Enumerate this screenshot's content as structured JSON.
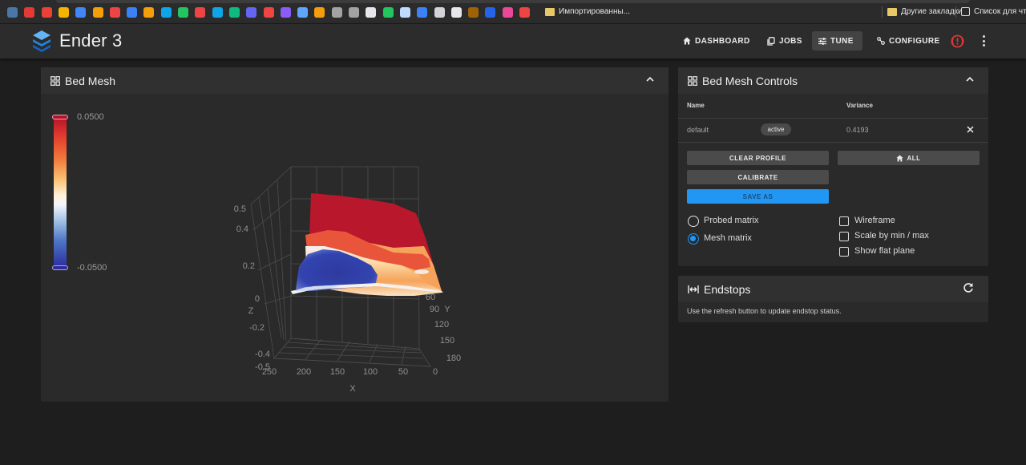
{
  "browser": {
    "bookmark_folder_1": "Импортированны...",
    "bookmark_folder_2": "Другие закладки",
    "reading_list": "Список для чтени",
    "bookmark_icon_colors": [
      "#4a76a8",
      "#e53935",
      "#ea4335",
      "#f4b400",
      "#4285f4",
      "#f59e0b",
      "#ef4444",
      "#3b82f6",
      "#f59e0b",
      "#0ea5e9",
      "#22c55e",
      "#ef4444",
      "#0ea5e9",
      "#10b981",
      "#6366f1",
      "#ef4444",
      "#8b5cf6",
      "#60a5fa",
      "#f59e0b",
      "#a3a3a3",
      "#a3a3a3",
      "#e5e7eb",
      "#22c55e",
      "#bfdbfe",
      "#3b82f6",
      "#d4d4d8",
      "#e5e7eb",
      "#a16207",
      "#2563eb",
      "#ec4899",
      "#ef4444"
    ]
  },
  "app": {
    "title": "Ender 3",
    "nav": {
      "dashboard": "DASHBOARD",
      "jobs": "JOBS",
      "tune": "TUNE",
      "configure": "CONFIGURE"
    }
  },
  "bed_mesh": {
    "title": "Bed Mesh",
    "legend_max": "0.0500",
    "legend_min": "-0.0500",
    "z_ticks": [
      "0.5",
      "0.4",
      "0.2",
      "0",
      "-0.2",
      "-0.4",
      "-0.5"
    ],
    "z_label": "Z",
    "x_ticks": [
      "250",
      "200",
      "150",
      "100",
      "50",
      "0"
    ],
    "x_label": "X",
    "y_ticks": [
      "60",
      "90",
      "120",
      "150",
      "180"
    ],
    "y_label": "Y"
  },
  "controls": {
    "title": "Bed Mesh Controls",
    "col_name": "Name",
    "col_variance": "Variance",
    "profile_name": "default",
    "profile_status": "active",
    "profile_variance": "0.4193",
    "clear_profile": "CLEAR PROFILE",
    "home_all": "ALL",
    "calibrate": "CALIBRATE",
    "save_as": "SAVE AS",
    "probed_matrix": "Probed matrix",
    "mesh_matrix": "Mesh matrix",
    "selected_matrix": "Mesh matrix",
    "wireframe": "Wireframe",
    "scale_by_minmax": "Scale by min / max",
    "show_flat_plane": "Show flat plane"
  },
  "endstops": {
    "title": "Endstops",
    "message": "Use the refresh button to update endstop status."
  }
}
